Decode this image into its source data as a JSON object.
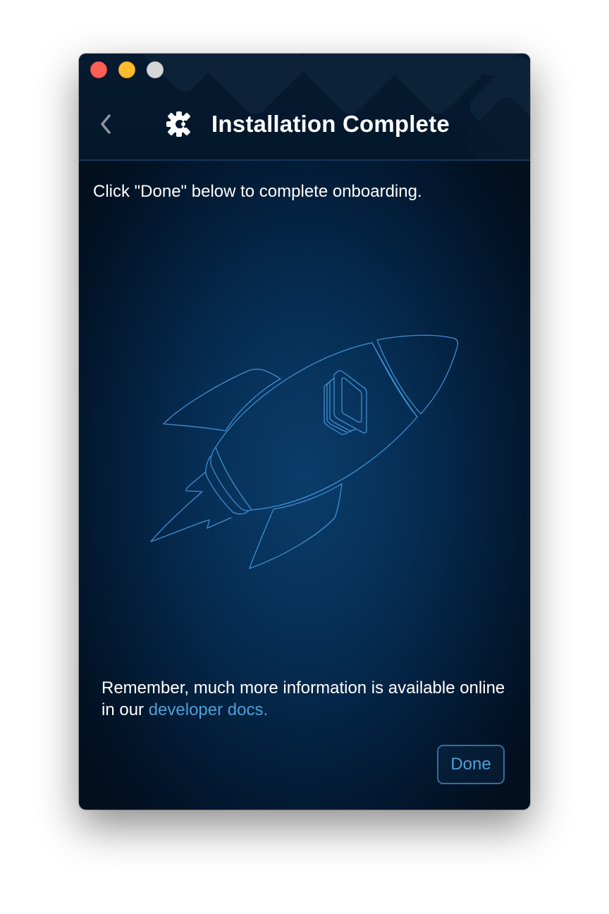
{
  "window": {
    "title": "Installation Complete",
    "controls": [
      "close",
      "minimize",
      "zoom"
    ]
  },
  "header": {
    "back_icon": "chevron-left-icon",
    "logo_icon": "gear-logo-icon",
    "title": "Installation Complete"
  },
  "body": {
    "instruction": "Click \"Done\" below to complete onboarding.",
    "illustration": "rocket-illustration",
    "footer_text": "Remember, much more information is available online in our ",
    "docs_link": "developer docs."
  },
  "actions": {
    "done_label": "Done"
  },
  "colors": {
    "accent": "#4f9fd8",
    "background_dark": "#020f1f",
    "background_glow": "#0a3d6a",
    "title_text": "#ffffff",
    "button_border": "#3a6d9c"
  }
}
